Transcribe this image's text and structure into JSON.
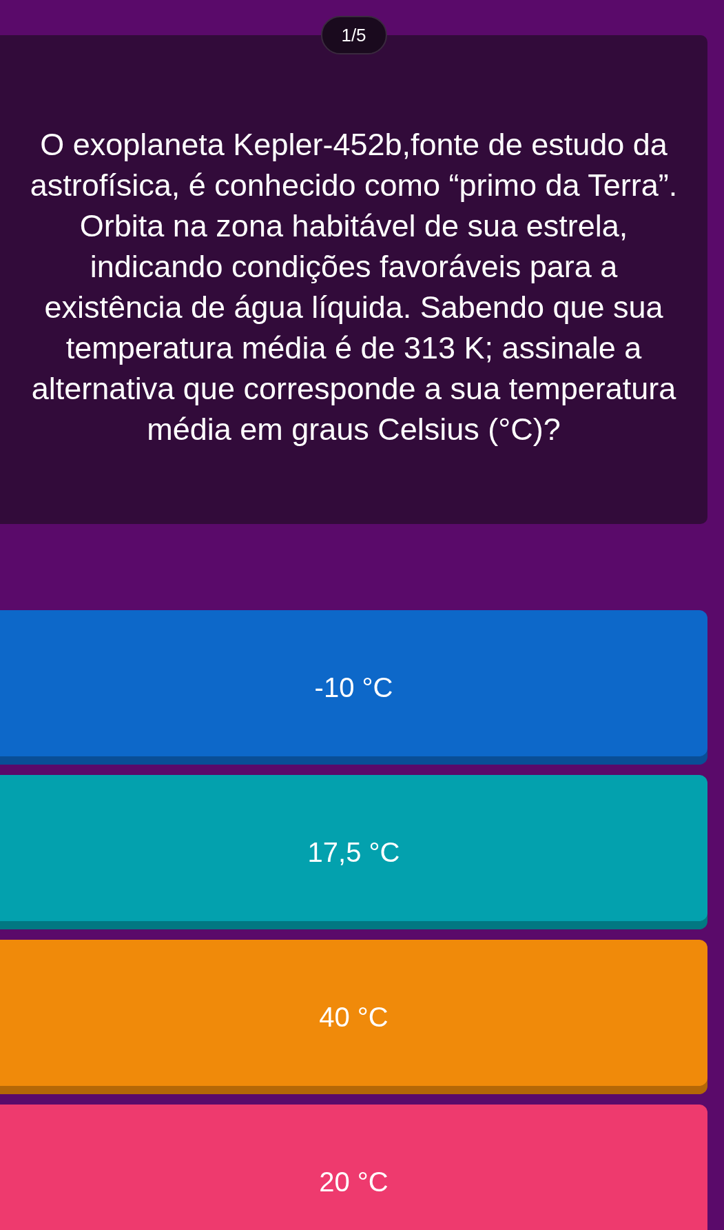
{
  "counter": "1/5",
  "question": "O exoplaneta Kepler-452b,fonte de estudo da astrofísica, é conhecido como “primo da Terra”. Orbita na zona habitável de sua estrela, indicando condições favoráveis para a existência de água líquida. Sabendo que sua temperatura média é de 313 K; assinale a alternativa que corresponde a sua temperatura média em graus Celsius (°C)?",
  "answers": [
    {
      "label": "-10 °C",
      "color": "#0d68c9"
    },
    {
      "label": "17,5 °C",
      "color": "#03a1ae"
    },
    {
      "label": "40 °C",
      "color": "#f08a0a"
    },
    {
      "label": "20 °C",
      "color": "#ee3a6e"
    }
  ]
}
